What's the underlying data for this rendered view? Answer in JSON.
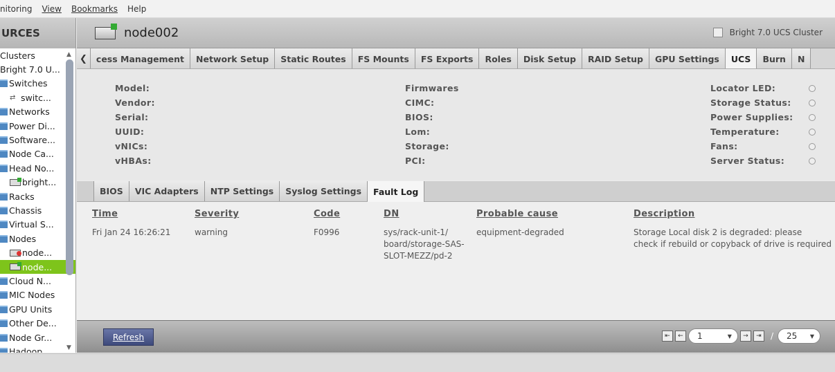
{
  "menu": [
    "nitoring",
    "View",
    "Bookmarks",
    "Help"
  ],
  "left": {
    "header": "URCES",
    "items": [
      {
        "label": "Clusters",
        "icon": "none",
        "level": 1
      },
      {
        "label": "Bright 7.0 U...",
        "icon": "none",
        "level": 1
      },
      {
        "label": "Switches",
        "icon": "folder",
        "level": 1
      },
      {
        "label": "switc...",
        "icon": "switch",
        "level": 2
      },
      {
        "label": "Networks",
        "icon": "folder",
        "level": 1
      },
      {
        "label": "Power Di...",
        "icon": "folder",
        "level": 1
      },
      {
        "label": "Software...",
        "icon": "folder",
        "level": 1
      },
      {
        "label": "Node Ca...",
        "icon": "folder",
        "level": 1
      },
      {
        "label": "Head No...",
        "icon": "folder",
        "level": 1
      },
      {
        "label": "bright...",
        "icon": "node-up",
        "level": 2
      },
      {
        "label": "Racks",
        "icon": "folder",
        "level": 1
      },
      {
        "label": "Chassis",
        "icon": "folder",
        "level": 1
      },
      {
        "label": "Virtual S...",
        "icon": "folder",
        "level": 1
      },
      {
        "label": "Nodes",
        "icon": "folder",
        "level": 1
      },
      {
        "label": "node...",
        "icon": "node-down",
        "level": 2
      },
      {
        "label": "node...",
        "icon": "node-up",
        "level": 2,
        "selected": true
      },
      {
        "label": "Cloud N...",
        "icon": "folder",
        "level": 1
      },
      {
        "label": "MIC Nodes",
        "icon": "folder",
        "level": 1
      },
      {
        "label": "GPU Units",
        "icon": "folder",
        "level": 1
      },
      {
        "label": "Other De...",
        "icon": "folder",
        "level": 1
      },
      {
        "label": "Node Gr...",
        "icon": "folder",
        "level": 1
      },
      {
        "label": "Hadoop",
        "icon": "folder",
        "level": 1
      }
    ]
  },
  "header": {
    "node_title": "node002",
    "cluster_label": "Bright 7.0 UCS Cluster"
  },
  "tabs": [
    "cess Management",
    "Network Setup",
    "Static Routes",
    "FS Mounts",
    "FS Exports",
    "Roles",
    "Disk Setup",
    "RAID Setup",
    "GPU Settings",
    "UCS",
    "Burn",
    "N"
  ],
  "active_tab": "UCS",
  "info": {
    "col1": [
      "Model:",
      "Vendor:",
      "Serial:",
      "UUID:",
      "vNICs:",
      "vHBAs:"
    ],
    "col2": [
      "Firmwares",
      "CIMC:",
      "BIOS:",
      "Lom:",
      "Storage:",
      "PCI:"
    ],
    "col3": [
      "Locator LED:",
      "Storage Status:",
      "Power Supplies:",
      "Temperature:",
      "Fans:",
      "Server Status:"
    ]
  },
  "subtabs": [
    "BIOS",
    "VIC Adapters",
    "NTP Settings",
    "Syslog Settings",
    "Fault Log"
  ],
  "active_subtab": "Fault Log",
  "fault_table": {
    "headers": {
      "time": "Time",
      "severity": "Severity",
      "code": "Code",
      "dn": "DN",
      "cause": "Probable cause",
      "desc": "Description"
    },
    "rows": [
      {
        "time": "Fri Jan 24 16:26:21",
        "severity": "warning",
        "code": "F0996",
        "dn_lines": [
          "sys/rack-unit-1/",
          "board/storage-SAS-",
          "SLOT-MEZZ/pd-2"
        ],
        "cause": "equipment-degraded",
        "desc_lines": [
          "Storage Local disk 2 is degraded: please",
          "check if rebuild or copyback of drive is required"
        ]
      }
    ]
  },
  "bottom": {
    "refresh_label": "Refresh",
    "page_value": "1",
    "per_page": "25"
  }
}
